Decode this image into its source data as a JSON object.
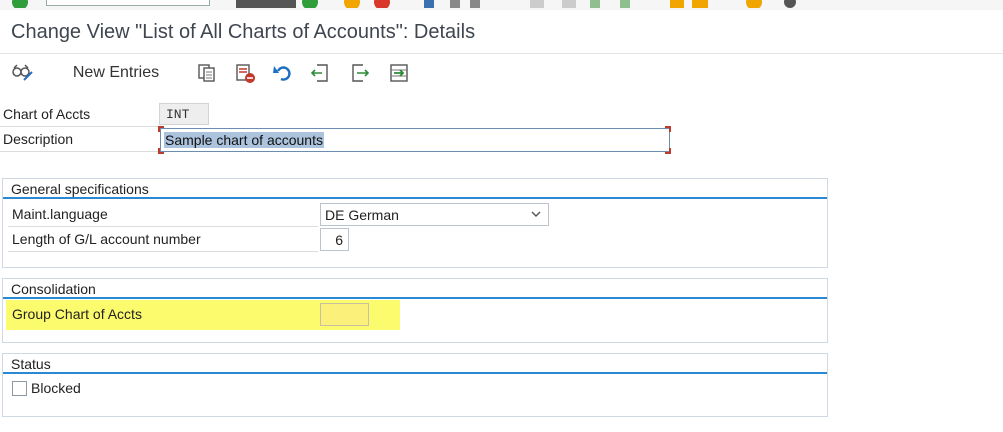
{
  "window": {
    "title": "Change View \"List of All Charts of Accounts\": Details"
  },
  "toolbar": {
    "new_entries_label": "New Entries",
    "icons": [
      "display-change-icon",
      "copy-icon",
      "delete-icon",
      "undo-icon",
      "previous-entry-icon",
      "next-entry-icon",
      "select-all-icon"
    ]
  },
  "header_fields": {
    "chart_of_accts_label": "Chart of Accts",
    "chart_of_accts_value": "INT",
    "description_label": "Description",
    "description_value": "Sample chart of accounts"
  },
  "general": {
    "title": "General specifications",
    "maint_language_label": "Maint.language",
    "maint_language_value": "DE German",
    "gl_length_label": "Length of G/L account number",
    "gl_length_value": "6"
  },
  "consolidation": {
    "title": "Consolidation",
    "group_chart_label": "Group Chart of Accts",
    "group_chart_value": ""
  },
  "status": {
    "title": "Status",
    "blocked_label": "Blocked",
    "blocked_checked": false
  },
  "colors": {
    "highlight": "#fcfb6e",
    "group_header_line": "#2a8ad1",
    "title_text": "#3f4650"
  }
}
